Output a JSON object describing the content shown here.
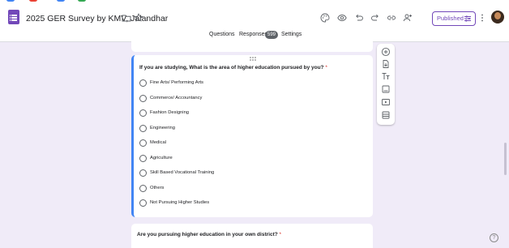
{
  "app": {
    "title": "2025 GER Survey by KMV, Jalandhar",
    "published_label": "Published",
    "colors": {
      "accent": "#7248b9",
      "background": "#f0ebf8",
      "active_question": "#4285f4",
      "required": "#d93025"
    }
  },
  "tabs": [
    {
      "label": "Questions"
    },
    {
      "label": "Responses"
    },
    {
      "label": "Settings"
    }
  ],
  "responses_count": "599",
  "question": {
    "title": "If you are studying, What is the area of higher education pursued by you?",
    "required_mark": "*",
    "options": [
      "Fine Arts/ Performing Arts",
      "Commerce/ Accountancy",
      "Fashion Designing",
      "Engineering",
      "Medical",
      "Agriculture",
      "Skill Based Vocational Training",
      "Others",
      "Not Pursuing Higher Studies"
    ]
  },
  "next_question": {
    "title": "Are you pursuing higher education in your own district?",
    "required_mark": "*"
  },
  "toolbar_icons": [
    "palette-icon",
    "preview-eye-icon",
    "undo-icon",
    "redo-icon",
    "link-icon",
    "add-collaborator-icon",
    "more-vert-icon"
  ],
  "side_tools": [
    "add-question-icon",
    "import-questions-icon",
    "add-title-icon",
    "add-image-icon",
    "add-video-icon",
    "add-section-icon"
  ],
  "help_label": "?"
}
